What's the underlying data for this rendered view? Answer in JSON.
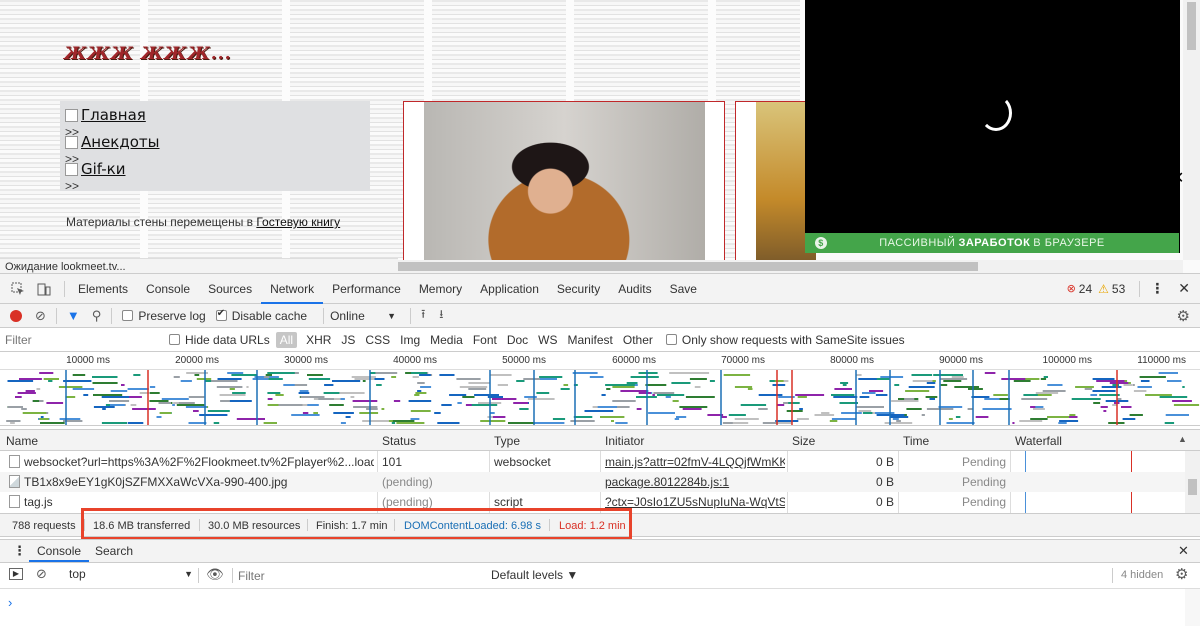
{
  "webpage": {
    "logo_text": "ЖЖЖ ЖЖЖ...",
    "nav": [
      {
        "label": "Главная",
        "sep": ">>"
      },
      {
        "label": "Анекдоты",
        "sep": ">>"
      },
      {
        "label": "Gif-ки",
        "sep": ">>"
      }
    ],
    "notice_prefix": "Материалы стены перемещены в ",
    "notice_link": "Гостевую книгу",
    "banner": {
      "prefix": "ПАССИВНЫЙ",
      "bold": "ЗАРАБОТОК",
      "suffix": "В БРАУЗЕРЕ",
      "icon": "$"
    },
    "status": "Ожидание lookmeet.tv..."
  },
  "devtools": {
    "tabs": [
      "Elements",
      "Console",
      "Sources",
      "Network",
      "Performance",
      "Memory",
      "Application",
      "Security",
      "Audits",
      "Save"
    ],
    "active_tab": "Network",
    "errors": "24",
    "warnings": "53",
    "toolbar": {
      "preserve_log": "Preserve log",
      "disable_cache": "Disable cache",
      "throttle": "Online"
    },
    "filter": {
      "placeholder": "Filter",
      "hide_data_urls": "Hide data URLs",
      "types": [
        "All",
        "XHR",
        "JS",
        "CSS",
        "Img",
        "Media",
        "Font",
        "Doc",
        "WS",
        "Manifest",
        "Other"
      ],
      "samesite": "Only show requests with SameSite issues"
    },
    "timeline_ticks": [
      "10000 ms",
      "20000 ms",
      "30000 ms",
      "40000 ms",
      "50000 ms",
      "60000 ms",
      "70000 ms",
      "80000 ms",
      "90000 ms",
      "100000 ms",
      "110000 ms"
    ],
    "columns": [
      "Name",
      "Status",
      "Type",
      "Initiator",
      "Size",
      "Time",
      "Waterfall"
    ],
    "rows": [
      {
        "name": "websocket?url=https%3A%2F%2Flookmeet.tv%2Fplayer%2...loader%...",
        "status": "101",
        "type": "websocket",
        "initiator": "main.js?attr=02fmV-4LQQjfWmKK...",
        "size": "0 B",
        "time": "Pending"
      },
      {
        "name": "TB1x8x9eEY1gK0jSZFMXXaWcVXa-990-400.jpg",
        "status": "(pending)",
        "type": "",
        "initiator": "package.8012284b.js:1",
        "size": "0 B",
        "time": "Pending"
      },
      {
        "name": "tag.js",
        "status": "(pending)",
        "type": "script",
        "initiator": "?ctx=J0sIo1ZU5sNupIuNa-WqVtS...",
        "size": "0 B",
        "time": "Pending"
      }
    ],
    "summary": {
      "requests": "788 requests",
      "transferred": "18.6 MB transferred",
      "resources": "30.0 MB resources",
      "finish": "Finish: 1.7 min",
      "dcl": "DOMContentLoaded: 6.98 s",
      "load": "Load: 1.2 min"
    },
    "drawer_tabs": [
      "Console",
      "Search"
    ],
    "console": {
      "context": "top",
      "filter_placeholder": "Filter",
      "levels": "Default levels ▼",
      "hidden": "4 hidden",
      "prompt": "›"
    }
  },
  "colors": {
    "accent": "#1a73e8",
    "dcl": "#1a6fb5",
    "load": "#d93025",
    "highlight": "#e8432b",
    "banner": "#44a54a"
  }
}
